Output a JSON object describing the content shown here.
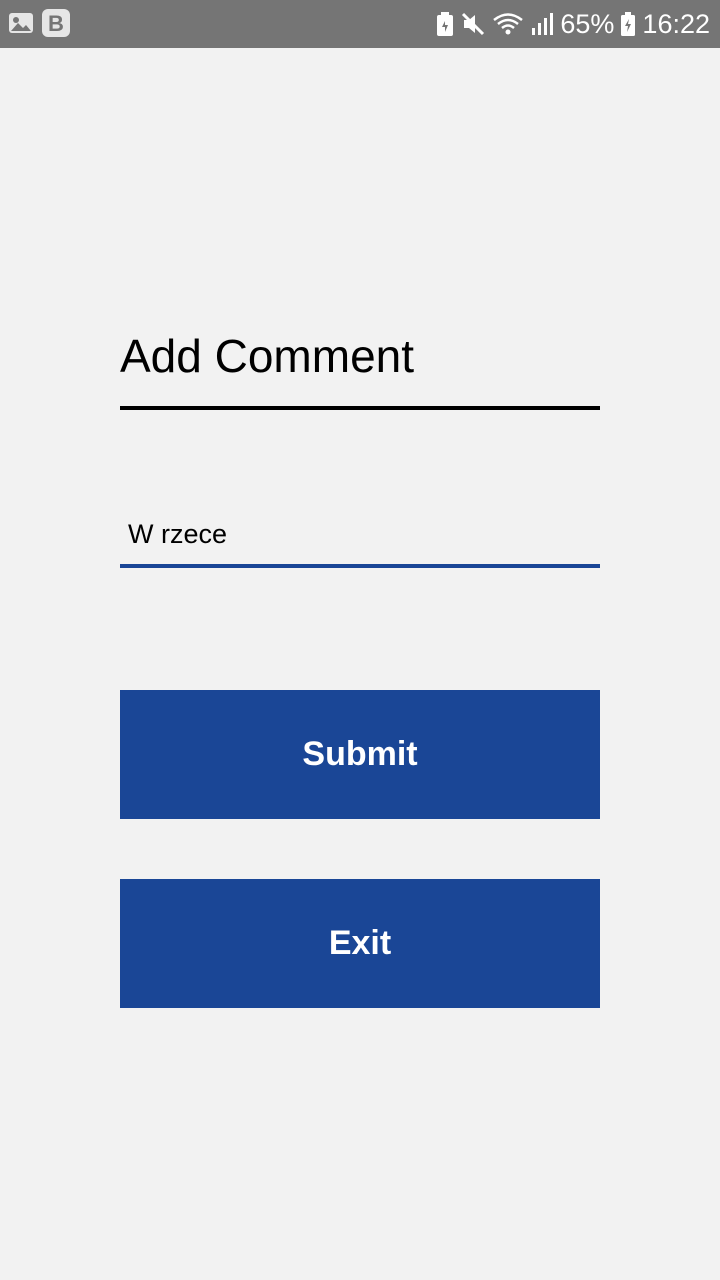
{
  "status_bar": {
    "left_icons": [
      "image-icon",
      "b-app-icon"
    ],
    "right_icons": [
      "battery-saver-icon",
      "mute-icon",
      "wifi-icon",
      "signal-icon"
    ],
    "battery_percent": "65%",
    "time": "16:22",
    "background_color": "#757575"
  },
  "screen": {
    "title": "Add Comment",
    "comment_input": {
      "value": "W rzece",
      "underline_color": "#1a4696"
    },
    "submit_label": "Submit",
    "exit_label": "Exit",
    "button_color": "#1a4696",
    "background_color": "#f2f2f2"
  }
}
